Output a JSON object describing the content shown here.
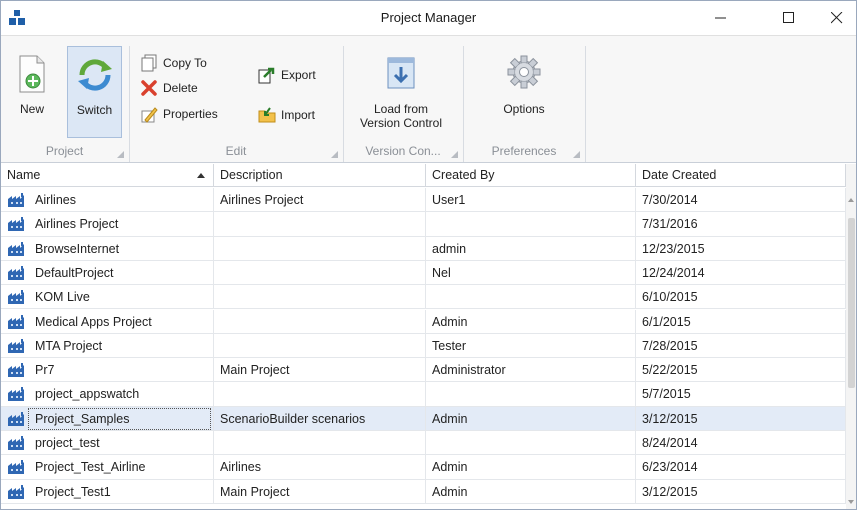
{
  "window": {
    "title": "Project Manager",
    "app_icon": "blue-cubes-icon"
  },
  "ribbon": {
    "groups": {
      "project": {
        "label": "Project"
      },
      "edit": {
        "label": "Edit"
      },
      "version_control": {
        "label": "Version Con..."
      },
      "preferences": {
        "label": "Preferences"
      }
    },
    "buttons": {
      "new": "New",
      "switch": "Switch",
      "copy_to": "Copy To",
      "delete": "Delete",
      "properties": "Properties",
      "export": "Export",
      "import": "Import",
      "load_from_line1": "Load from",
      "load_from_line2": "Version Control",
      "options": "Options"
    },
    "active_button": "Switch"
  },
  "grid": {
    "columns": [
      "Name",
      "Description",
      "Created By",
      "Date Created"
    ],
    "sort_column": "Name",
    "sort_direction": "ascending",
    "selected_row": "Project_Samples",
    "rows": [
      {
        "name": "Airlines",
        "description": "Airlines Project",
        "created_by": "User1",
        "date": "7/30/2014"
      },
      {
        "name": "Airlines Project",
        "description": "",
        "created_by": "",
        "date": "7/31/2016"
      },
      {
        "name": "BrowseInternet",
        "description": "",
        "created_by": "admin",
        "date": "12/23/2015"
      },
      {
        "name": "DefaultProject",
        "description": "",
        "created_by": "Nel",
        "date": "12/24/2014"
      },
      {
        "name": "KOM Live",
        "description": "",
        "created_by": "",
        "date": "6/10/2015"
      },
      {
        "name": "Medical Apps Project",
        "description": "",
        "created_by": "Admin",
        "date": "6/1/2015"
      },
      {
        "name": "MTA Project",
        "description": "",
        "created_by": "Tester",
        "date": "7/28/2015"
      },
      {
        "name": "Pr7",
        "description": "Main Project",
        "created_by": "Administrator",
        "date": "5/22/2015"
      },
      {
        "name": "project_appswatch",
        "description": "",
        "created_by": "",
        "date": "5/7/2015"
      },
      {
        "name": "Project_Samples",
        "description": "ScenarioBuilder scenarios",
        "created_by": "Admin",
        "date": "3/12/2015"
      },
      {
        "name": "project_test",
        "description": "",
        "created_by": "",
        "date": "8/24/2014"
      },
      {
        "name": "Project_Test_Airline",
        "description": "Airlines",
        "created_by": "Admin",
        "date": "6/23/2014"
      },
      {
        "name": "Project_Test1",
        "description": "Main Project",
        "created_by": "Admin",
        "date": "3/12/2015"
      }
    ]
  },
  "colors": {
    "accent": "#3a6fb5",
    "selection": "#e3ebf7",
    "ribbon_bg": "#f7f7f7"
  }
}
